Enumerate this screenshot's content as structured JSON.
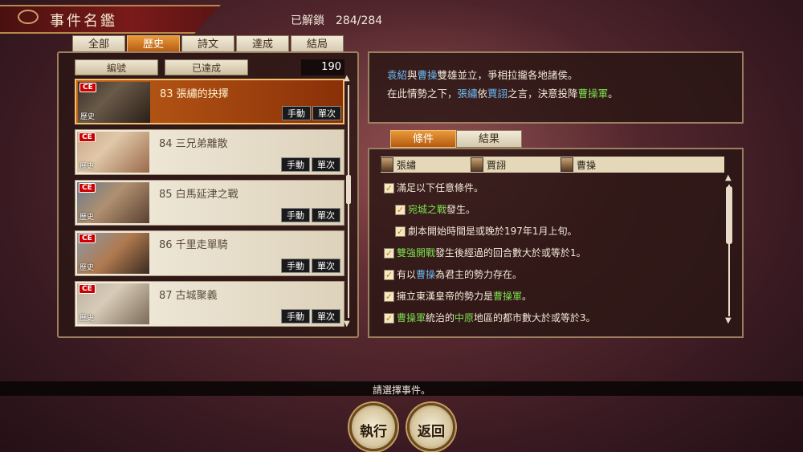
{
  "header": {
    "title": "事件名鑑",
    "unlock_label": "已解鎖",
    "unlock_value": "284/284"
  },
  "tabs": [
    {
      "label": "全部",
      "active": false
    },
    {
      "label": "歷史",
      "active": true
    },
    {
      "label": "詩文",
      "active": false
    },
    {
      "label": "達成",
      "active": false
    },
    {
      "label": "結局",
      "active": false
    }
  ],
  "sort": {
    "number_label": "編號",
    "achieved_label": "已達成",
    "count": "190"
  },
  "events": [
    {
      "badge": "CE",
      "category": "歷史",
      "title": "83 張繡的抉擇",
      "mode": "手動",
      "freq": "單次",
      "selected": true
    },
    {
      "badge": "CE",
      "category": "歷史",
      "title": "84 三兄弟離散",
      "mode": "手動",
      "freq": "單次",
      "selected": false
    },
    {
      "badge": "CE",
      "category": "歷史",
      "title": "85 白馬延津之戰",
      "mode": "手動",
      "freq": "單次",
      "selected": false
    },
    {
      "badge": "CE",
      "category": "歷史",
      "title": "86 千里走單騎",
      "mode": "手動",
      "freq": "單次",
      "selected": false
    },
    {
      "badge": "CE",
      "category": "歷史",
      "title": "87 古城聚義",
      "mode": "手動",
      "freq": "單次",
      "selected": false
    }
  ],
  "description": {
    "line1": [
      "袁紹",
      "與",
      "曹操",
      "雙雄並立，爭相拉攏各地諸侯。"
    ],
    "line2": [
      "在此情勢之下，",
      "張繡",
      "依",
      "賈詡",
      "之言，決意投降",
      "曹操軍",
      "。"
    ]
  },
  "detail_tabs": [
    {
      "label": "條件",
      "active": true
    },
    {
      "label": "結果",
      "active": false
    }
  ],
  "persons": [
    "張繡",
    "賈詡",
    "曹操"
  ],
  "conditions": {
    "c1": "滿足以下任意條件。",
    "c2_a": "宛城之戰",
    "c2_b": "發生。",
    "c3": "劇本開始時間是或晚於197年1月上旬。",
    "c4_a": "雙強開戰",
    "c4_b": "發生後經過的回合數大於或等於1。",
    "c5_a": "有以",
    "c5_b": "曹操",
    "c5_c": "為君主的勢力存在。",
    "c6_a": "擁立東漢皇帝的勢力是",
    "c6_b": "曹操軍",
    "c6_c": "。",
    "c7_a": "曹操軍",
    "c7_b": "統治的",
    "c7_c": "中原",
    "c7_d": "地區的都市數大於或等於3。"
  },
  "status": "請選擇事件。",
  "buttons": {
    "execute": "執行",
    "back": "返回"
  },
  "colors": {
    "accent": "#c06018",
    "blue_name": "#6ab8f0",
    "green_name": "#7add4e"
  }
}
